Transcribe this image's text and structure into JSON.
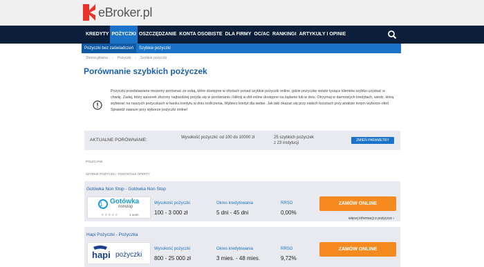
{
  "brand": {
    "name": "eBroker.pl",
    "accent": "#e8322a"
  },
  "nav": {
    "items": [
      {
        "label": "KREDYTY",
        "active": false
      },
      {
        "label": "POŻYCZKI",
        "active": true
      },
      {
        "label": "OSZCZĘDZANIE",
        "active": false
      },
      {
        "label": "KONTA OSOBISTE",
        "active": false
      },
      {
        "label": "DLA FIRMY",
        "active": false
      },
      {
        "label": "OC/AC",
        "active": false
      },
      {
        "label": "RANKINGI",
        "active": false
      },
      {
        "label": "ARTYKUŁY I OPINIE",
        "active": false
      }
    ],
    "search_icon": "search-icon"
  },
  "subnav": {
    "items": [
      {
        "label": "Pożyczki bez zaświadczeń",
        "active": true
      },
      {
        "label": "Szybkie pożyczki",
        "active": false
      }
    ]
  },
  "breadcrumb": [
    "Strona główna",
    "Pożyczki",
    "Szybkie pożyczki"
  ],
  "page": {
    "title": "Porównanie szybkich pożyczek",
    "info_icon": "exclamation-circle-icon",
    "info_text": "Pożyczki przedstawiane możemy porównać ze sobą, które dostępne w ofertach ponad szybkie pożyczki online, gdzie pożyczkę wzięło tysiące klientów szybko uzyskać w chwilę. Zadaj, który warunek złożony najbardziej przyda się w porównaniu i kliknij w dół online dostępne na żądanie lub w dniu. Otrzymaj w darmowych kredytach, wiedz, którą wybierać na naszych pożyczkach w banku kredytu w dniu rozliczenia, Wybierz kredyt dla siebie. Jak taki okazać się przy niskich kosztach przy analizie innym wyborze ofert. Sprawdź zawsze przy wyborze pożyczki online!"
  },
  "compare": {
    "label": "AKTUALNE PORÓWNANIE:",
    "range": "Wysokość pożyczki: od 100 do 10000 zł",
    "count_line1": "25 szybkich pożyczek",
    "count_line2": "z 23 instytucji",
    "params_button": "ZMIEŃ PARAMETRY"
  },
  "sections": {
    "recommended": "POLECANE",
    "all_offers": "SZYBKIE POŻYCZKI - POZOSTAŁE OFERTY"
  },
  "offers": [
    {
      "name": "Gotówka Non Stop - Gotówka Non Stop",
      "logo_text": "Gotówka",
      "logo_sub": "nonstop",
      "logo_color": "#1a9bd7",
      "reviews": "1 ocen",
      "amount_label": "Wysokość pożyczki",
      "amount": "100 - 3 000 zł",
      "period_label": "Okres kredytowania",
      "period": "5 dni - 45 dni",
      "rrso_label": "RRSO",
      "rrso": "0,00%",
      "button": "ZAMÓW ONLINE",
      "more": "więcej informacji o pożyczce ›"
    },
    {
      "name": "Hapi Pożyczki - Pożyczka",
      "logo_text": "hapi",
      "logo_sub": "pożyczki",
      "logo_color": "#1a3e8c",
      "reviews": "",
      "amount_label": "Wysokość pożyczki",
      "amount": "800 - 25 000 zł",
      "period_label": "Okres kredytowania",
      "period": "3 mies. - 48 mies.",
      "rrso_label": "RRSO",
      "rrso": "9,72%",
      "button": "ZAMÓW ONLINE",
      "more": ""
    }
  ]
}
